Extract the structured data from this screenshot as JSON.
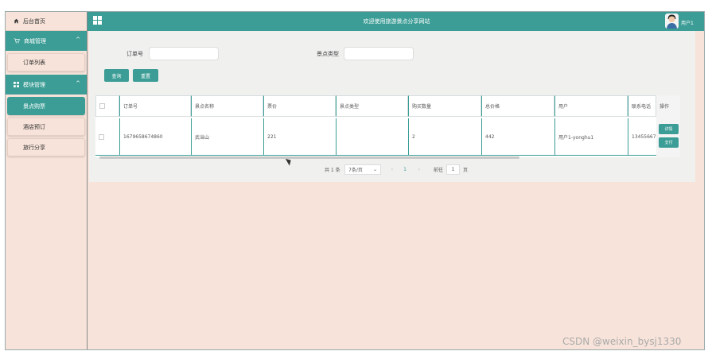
{
  "sidebar": {
    "home": "后台首页",
    "groups": [
      {
        "label": "商城管理",
        "items": [
          "订单列表"
        ]
      },
      {
        "label": "模块管理",
        "items": [
          "景点购票",
          "酒店预订",
          "旅行分享"
        ]
      }
    ]
  },
  "header": {
    "title": "欢迎使用旅游景点分享网站",
    "user": "用户1"
  },
  "search": {
    "order_label": "订单号",
    "type_label": "景点类型",
    "query_button": "查询",
    "reset_button": "重置"
  },
  "table": {
    "headers": [
      "订单号",
      "景点名称",
      "票价",
      "景点类型",
      "购买数量",
      "总价格",
      "用户",
      "联系电话",
      "操作"
    ],
    "rows": [
      {
        "cells": [
          "1679658674860",
          "武当山",
          "221",
          "",
          "2",
          "442",
          "用户1-yonghu1",
          "13455667"
        ],
        "actions": [
          "详情",
          "支付"
        ]
      }
    ]
  },
  "pagination": {
    "total": "共 1 条",
    "page_size": "7条/页",
    "current_page": "1",
    "goto_label": "前往",
    "goto_value": "1",
    "page_suffix": "页"
  },
  "watermark": "CSDN @weixin_bysj1330"
}
